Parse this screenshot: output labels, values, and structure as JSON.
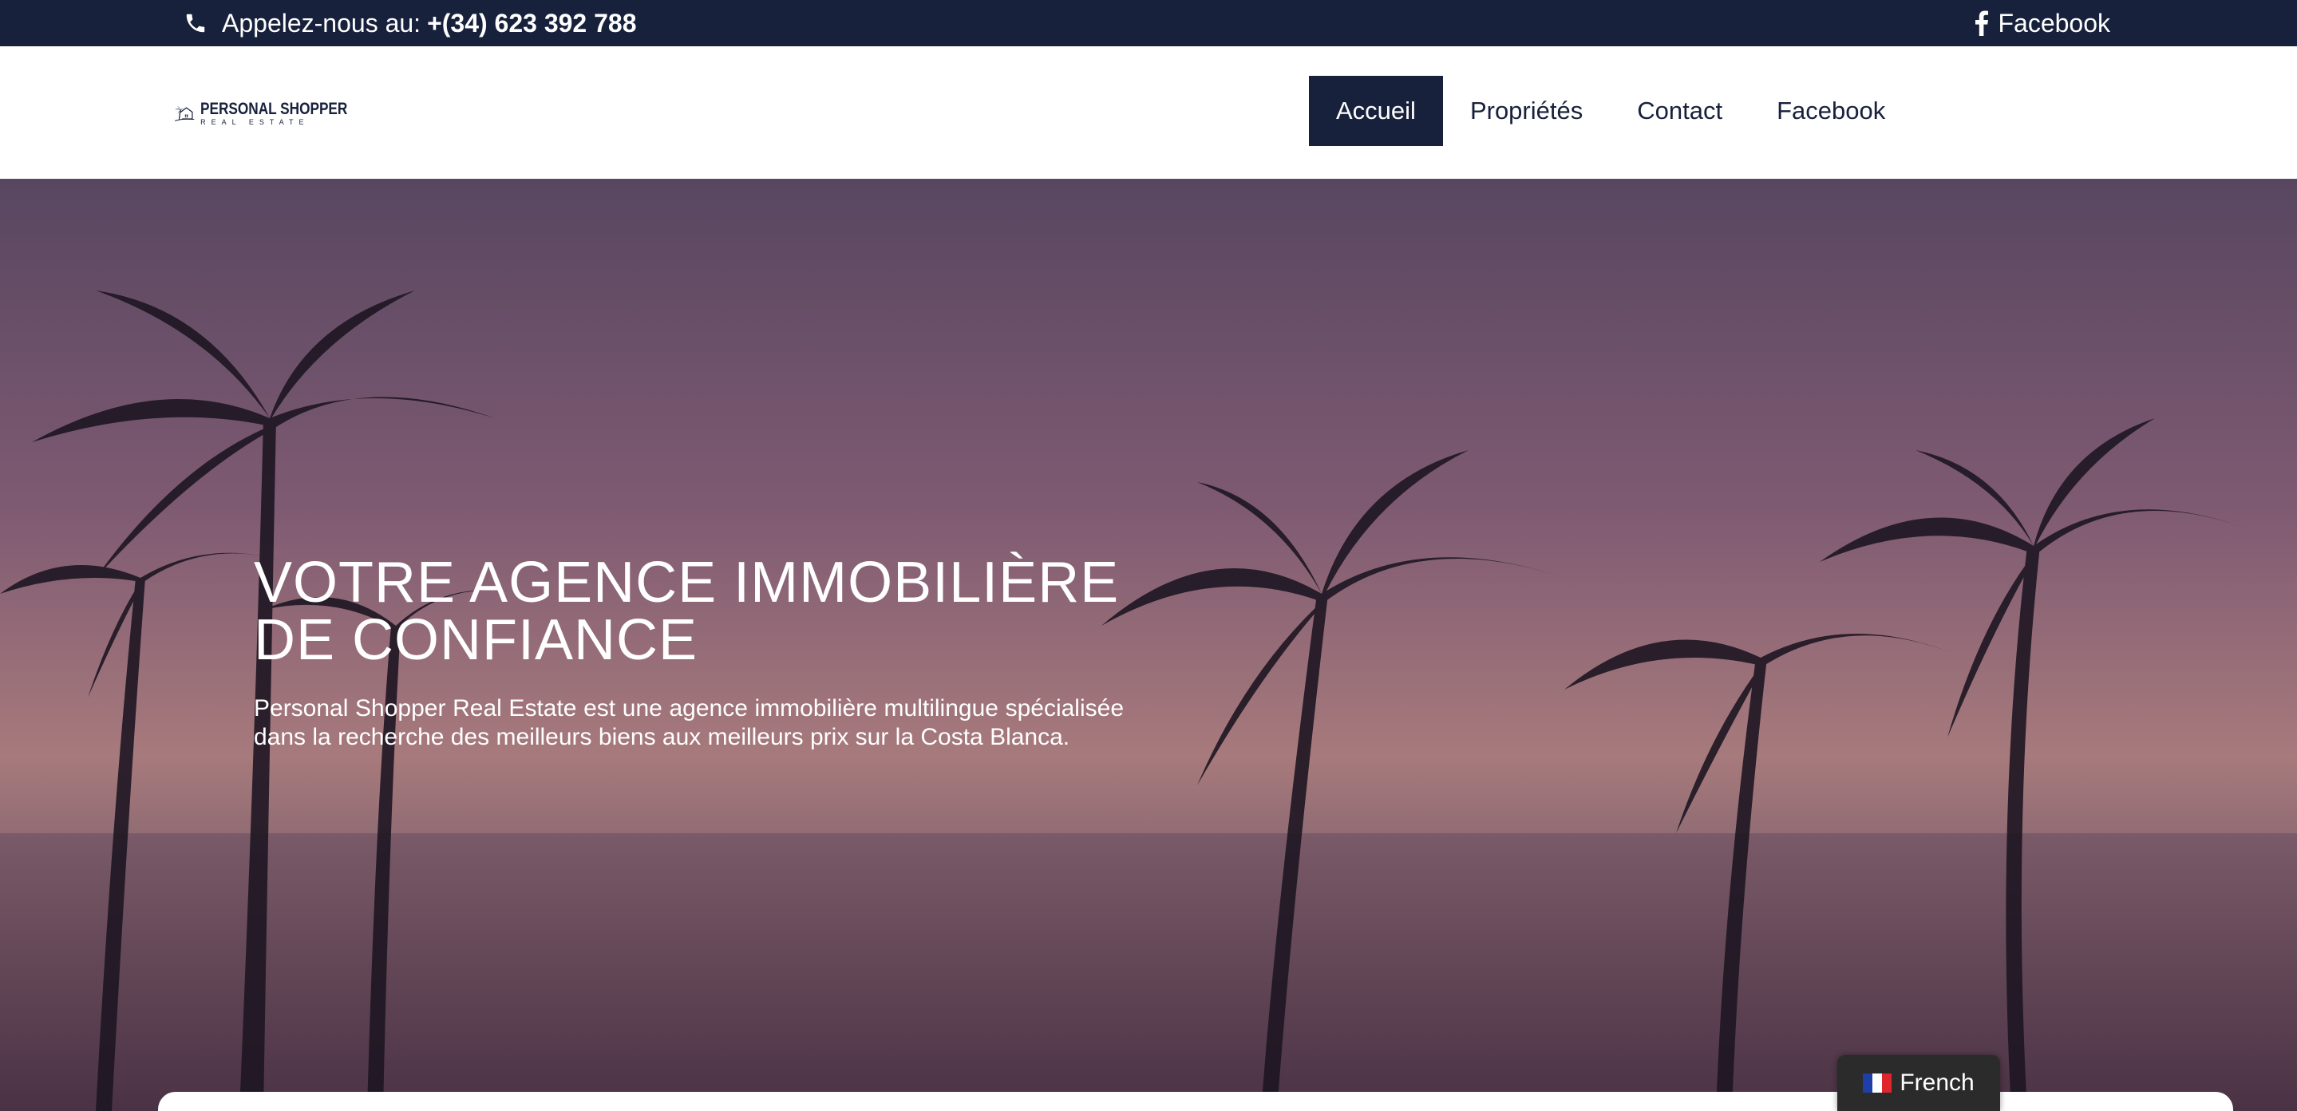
{
  "topbar": {
    "phone_prefix": "Appelez-nous au:",
    "phone_number": "+(34) 623 392 788",
    "facebook": "Facebook"
  },
  "logo": {
    "line1": "PERSONAL SHOPPER",
    "line2": "REAL ESTATE"
  },
  "nav": {
    "items": [
      "Accueil",
      "Propriétés",
      "Contact",
      "Facebook"
    ],
    "active": "Accueil"
  },
  "hero": {
    "title_line1": "VOTRE AGENCE IMMOBILIÈRE",
    "title_line2": "DE CONFIANCE",
    "text": "Personal Shopper Real Estate est une agence immobilière multilingue spécialisée dans la recherche des meilleurs biens aux meilleurs prix sur la Costa Blanca."
  },
  "language": {
    "label": "French"
  },
  "colors": {
    "navy": "#17213c",
    "white": "#ffffff"
  }
}
